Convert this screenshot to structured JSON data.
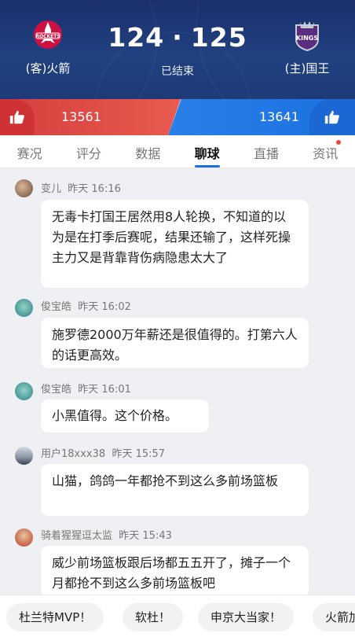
{
  "game": {
    "away_team": "(客)火箭",
    "home_team": "(主)国王",
    "away_logo_text": "ROCKETS",
    "home_logo_text": "KINGS",
    "away_score": "124",
    "separator": "·",
    "home_score": "125",
    "status": "已结束"
  },
  "votes": {
    "away_count": "13561",
    "home_count": "13641",
    "away_color": "#d63e3e",
    "home_color": "#1a71e0",
    "icon": "thumbs-up-icon"
  },
  "tabs": [
    {
      "label": "赛况"
    },
    {
      "label": "评分"
    },
    {
      "label": "数据"
    },
    {
      "label": "聊球",
      "active": true
    },
    {
      "label": "直播"
    },
    {
      "label": "资讯",
      "badge": true
    }
  ],
  "messages": [
    {
      "user": "变儿",
      "time": "昨天 16:16",
      "text": "无毒卡打国王居然用8人轮换，不知道的以为是在打季后赛呢，结果还输了，这样死操主力又是背靠背伤病隐患太大了"
    },
    {
      "user": "俊宝皓",
      "time": "昨天 16:02",
      "text": "施罗德2000万年薪还是很值得的。打第六人的话更高效。"
    },
    {
      "user": "俊宝皓",
      "time": "昨天 16:01",
      "text": "小黑值得。这个价格。"
    },
    {
      "user": "用户18xxx38",
      "time": "昨天 15:57",
      "text": "山猫，鸽鸽一年都抢不到这么多前场篮板"
    },
    {
      "user": "骑着猩猩逗太监",
      "time": "昨天 15:43",
      "text": "威少前场篮板跟后场都五五开了，摊子一个月都抢不到这么多前场篮板吧"
    }
  ],
  "quick_replies": [
    "杜兰特MVP！",
    "软杜！",
    "申京大当家！",
    "火箭加油"
  ],
  "accent": "#1c6fe0"
}
